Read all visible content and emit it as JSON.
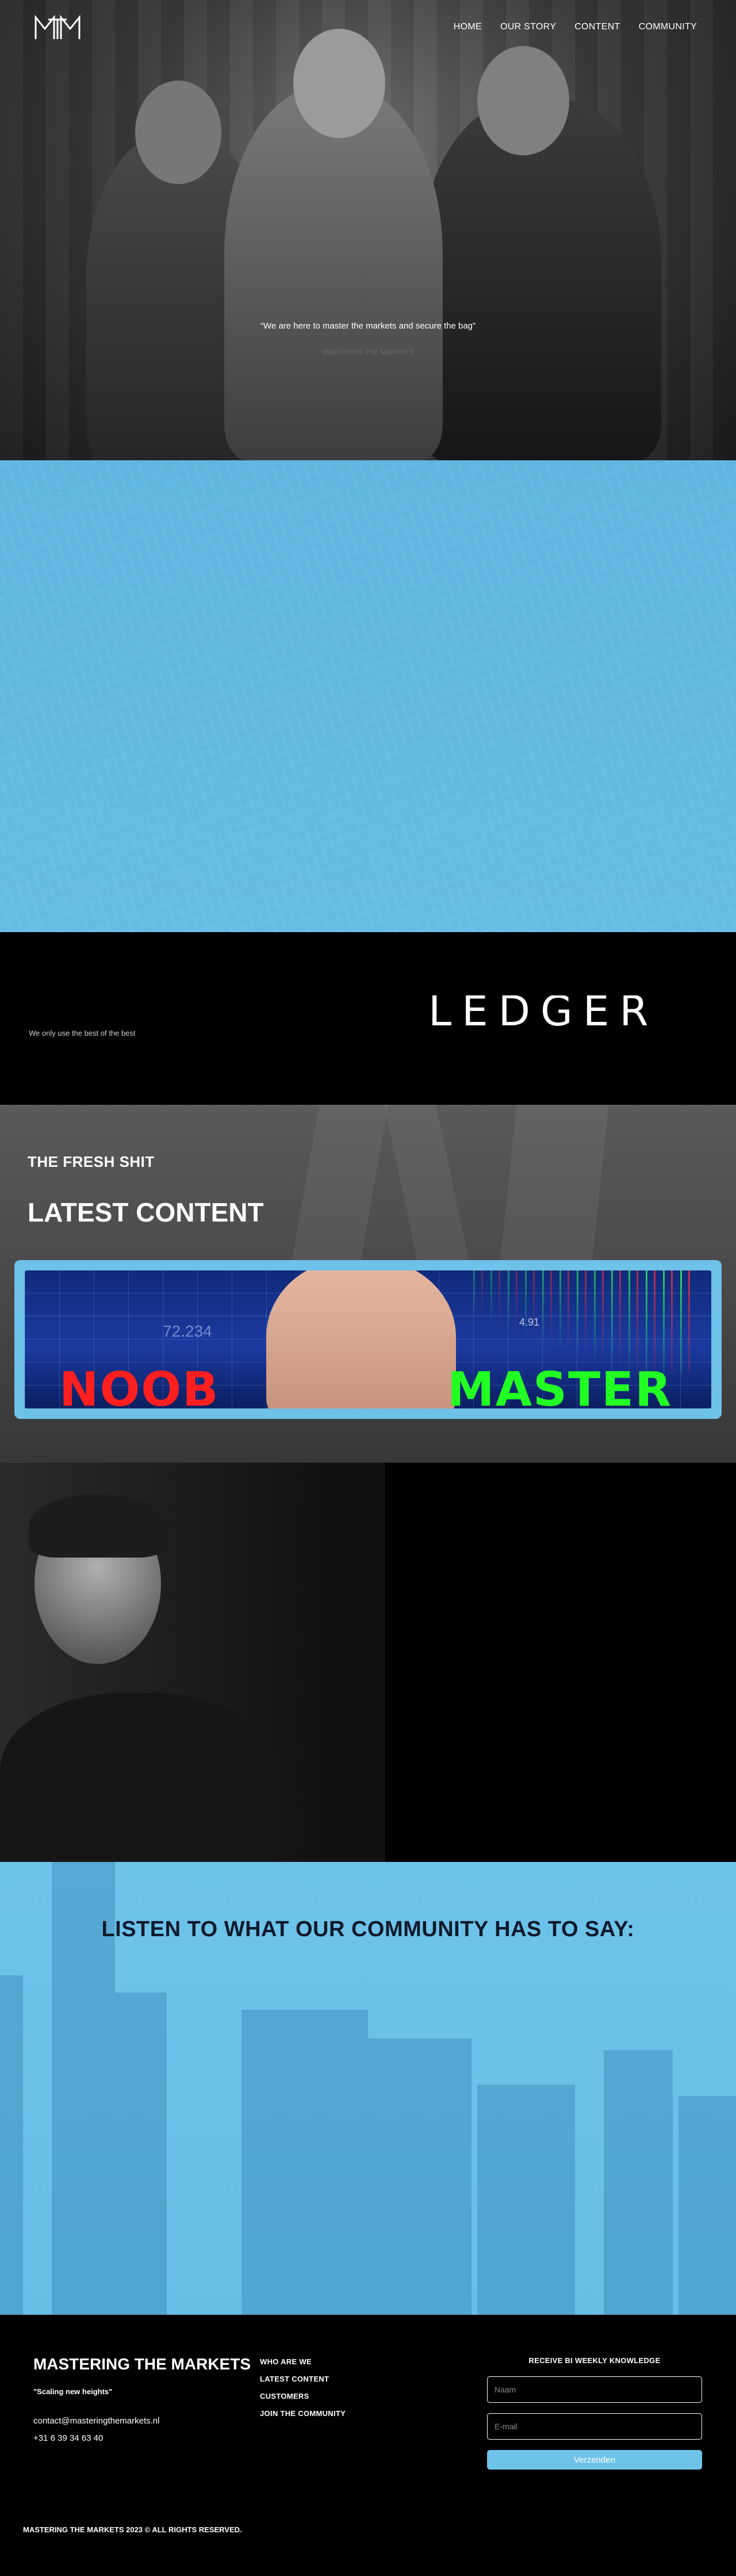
{
  "brand_colors": {
    "accent_blue": "#6ec3eb",
    "dark": "#000000"
  },
  "header": {
    "logo_icon": "mtm-monogram-logo",
    "nav": [
      {
        "label": "HOME"
      },
      {
        "label": "OUR STORY"
      },
      {
        "label": "CONTENT"
      },
      {
        "label": "COMMUNITY"
      }
    ]
  },
  "hero": {
    "quote": "“We are here to master the markets and secure the bag”",
    "author": "MASTERING THE MARKETS"
  },
  "sponsor": {
    "text": "We only use the best of the best",
    "logo_text": "LEDGER"
  },
  "content": {
    "eyebrow": "THE FRESH SHIT",
    "title": "LATEST CONTENT",
    "video": {
      "word_left": "NOOB",
      "word_right": "MASTER",
      "number_left": "72.234",
      "number_right": "4.91"
    },
    "prev_icon": "chevron-left-icon",
    "next_icon": "chevron-right-icon",
    "prev_glyph": "‹",
    "next_glyph": "›"
  },
  "testimonials": {
    "title": "LISTEN TO WHAT OUR COMMUNITY HAS TO SAY:"
  },
  "footer": {
    "brand": "MASTERING THE MARKETS",
    "tagline": "\"Scaling new heights\"",
    "email": "contact@masteringthemarkets.nl",
    "phone": "+31 6 39 34 63 40",
    "links": [
      {
        "label": "WHO ARE WE"
      },
      {
        "label": "LATEST CONTENT"
      },
      {
        "label": "CUSTOMERS"
      },
      {
        "label": "JOIN THE COMMUNITY"
      }
    ],
    "newsletter": {
      "title": "RECEIVE BI WEEKLY KNOWLEDGE",
      "name_placeholder": "Naam",
      "email_placeholder": "E-mail",
      "submit_label": "Verzenden"
    },
    "copyright": "MASTERING THE MARKETS 2023 © ALL RIGHTS RESERVED."
  }
}
